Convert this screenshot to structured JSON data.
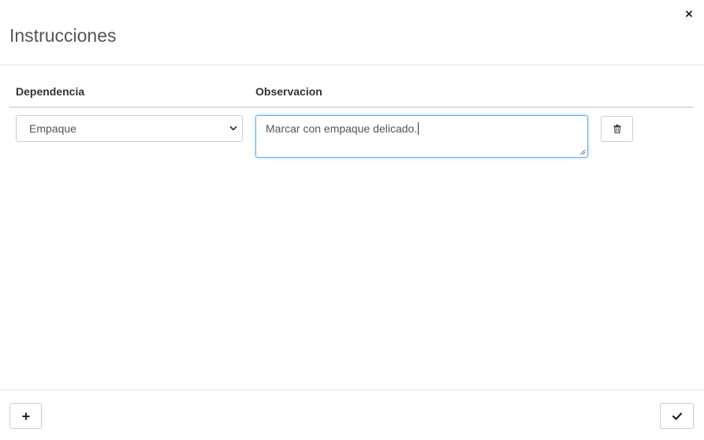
{
  "modal": {
    "title": "Instrucciones",
    "close_label": "×"
  },
  "table": {
    "headers": {
      "dependencia": "Dependencia",
      "observacion": "Observacion"
    },
    "rows": [
      {
        "dependencia": "Empaque",
        "observacion": "Marcar con empaque delicado."
      }
    ]
  },
  "icons": {
    "close": "close-icon",
    "select_arrow": "chevron-down-icon",
    "delete": "trash-icon",
    "add": "plus-icon",
    "confirm": "check-icon"
  },
  "colors": {
    "focus_border": "#66afe9",
    "border": "#cccccc",
    "header_divider": "#dddddd"
  }
}
